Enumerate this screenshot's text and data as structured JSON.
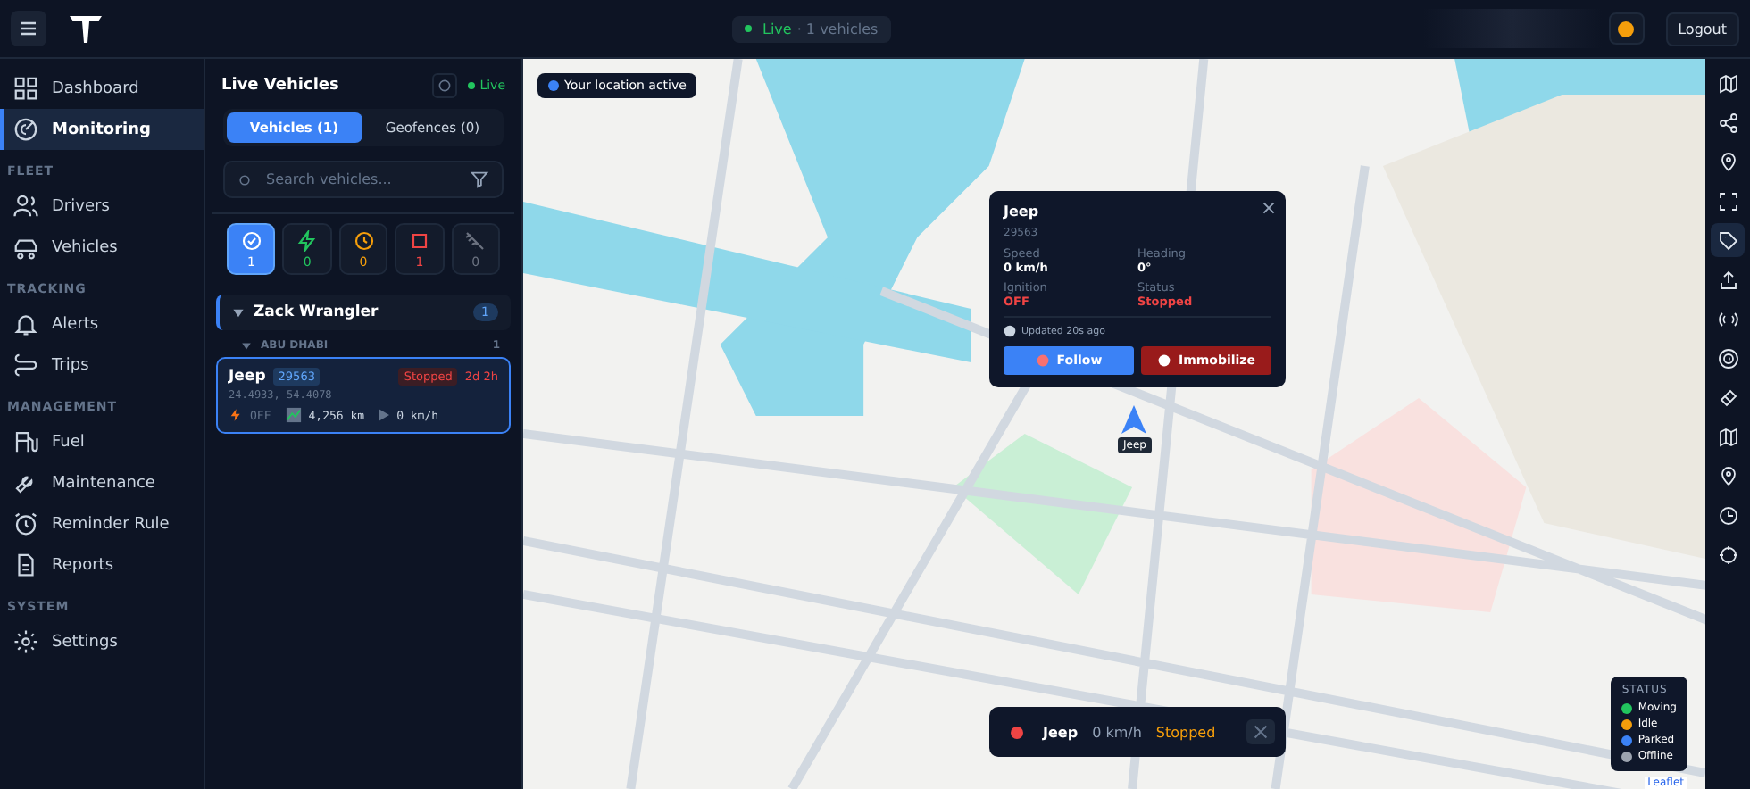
{
  "topbar": {
    "live_label": "Live",
    "live_text": "· 1 vehicles",
    "logout": "Logout"
  },
  "nav": [
    {
      "items": [
        {
          "label": "Dashboard",
          "selected": false
        },
        {
          "label": "Monitoring",
          "selected": true
        }
      ]
    },
    {
      "heading": "FLEET",
      "items": [
        {
          "label": "Drivers",
          "selected": false
        },
        {
          "label": "Vehicles",
          "selected": false
        }
      ]
    },
    {
      "heading": "TRACKING",
      "items": [
        {
          "label": "Alerts",
          "selected": false
        },
        {
          "label": "Trips",
          "selected": false
        }
      ]
    },
    {
      "heading": "MANAGEMENT",
      "items": [
        {
          "label": "Fuel",
          "selected": false
        },
        {
          "label": "Maintenance",
          "selected": false
        },
        {
          "label": "Reminder Rule",
          "selected": false
        },
        {
          "label": "Reports",
          "selected": false
        }
      ]
    },
    {
      "heading": "SYSTEM",
      "items": [
        {
          "label": "Settings",
          "selected": false
        }
      ]
    }
  ],
  "panel": {
    "title": "Live Vehicles",
    "live": "Live",
    "tabs": [
      {
        "label": "Vehicles (1)",
        "selected": true
      },
      {
        "label": "Geofences (0)",
        "selected": false
      }
    ],
    "search": {
      "placeholder": "Search vehicles..."
    },
    "filters": [
      {
        "count": "1",
        "selected": true,
        "color": "#ffffff"
      },
      {
        "count": "0",
        "selected": false,
        "color": "#22c55e"
      },
      {
        "count": "0",
        "selected": false,
        "color": "#f59e0b"
      },
      {
        "count": "1",
        "selected": false,
        "color": "#ef4444"
      },
      {
        "count": "0",
        "selected": false,
        "color": "#6b7280"
      }
    ],
    "group": {
      "name": "Zack Wrangler",
      "count": "1",
      "expanded": true,
      "region": {
        "name": "ABU DHABI",
        "count": "1",
        "vehicles": [
          {
            "name": "Jeep",
            "plate": "29563",
            "status": "Stopped",
            "duration": "2d 2h",
            "coords": "24.4933, 54.4078",
            "ignition": "OFF",
            "odometer": "4,256 km",
            "speed": "0 km/h",
            "selected": true
          }
        ]
      }
    }
  },
  "map": {
    "location_pill": "Your location active",
    "popup": {
      "title": "Jeep",
      "plate": "29563",
      "fields": [
        {
          "label": "Speed",
          "value": "0 km/h",
          "alert": false
        },
        {
          "label": "Heading",
          "value": "0°",
          "alert": false
        },
        {
          "label": "Ignition",
          "value": "OFF",
          "alert": true
        },
        {
          "label": "Status",
          "value": "Stopped",
          "alert": true
        }
      ],
      "updated": "Updated 20s ago",
      "buttons": [
        {
          "label": "Follow",
          "kind": "primary"
        },
        {
          "label": "Immobilize",
          "kind": "danger"
        }
      ]
    },
    "marker_label": "Jeep",
    "bottom_bar": {
      "name": "Jeep",
      "speed": "0 km/h",
      "status": "Stopped"
    },
    "legend": {
      "title": "STATUS",
      "items": [
        {
          "label": "Moving",
          "color": "#22c55e"
        },
        {
          "label": "Idle",
          "color": "#f59e0b"
        },
        {
          "label": "Parked",
          "color": "#3b82f6"
        },
        {
          "label": "Offline",
          "color": "#9ca3af"
        }
      ]
    },
    "attribution": "Leaflet"
  },
  "tools": [
    {
      "selected": false
    },
    {
      "selected": false
    },
    {
      "selected": false
    },
    {
      "selected": false
    },
    {
      "selected": true
    },
    {
      "selected": false
    },
    {
      "selected": false
    },
    {
      "selected": false
    },
    {
      "selected": false
    },
    {
      "selected": false
    },
    {
      "selected": false
    },
    {
      "selected": false
    },
    {
      "selected": false
    }
  ]
}
